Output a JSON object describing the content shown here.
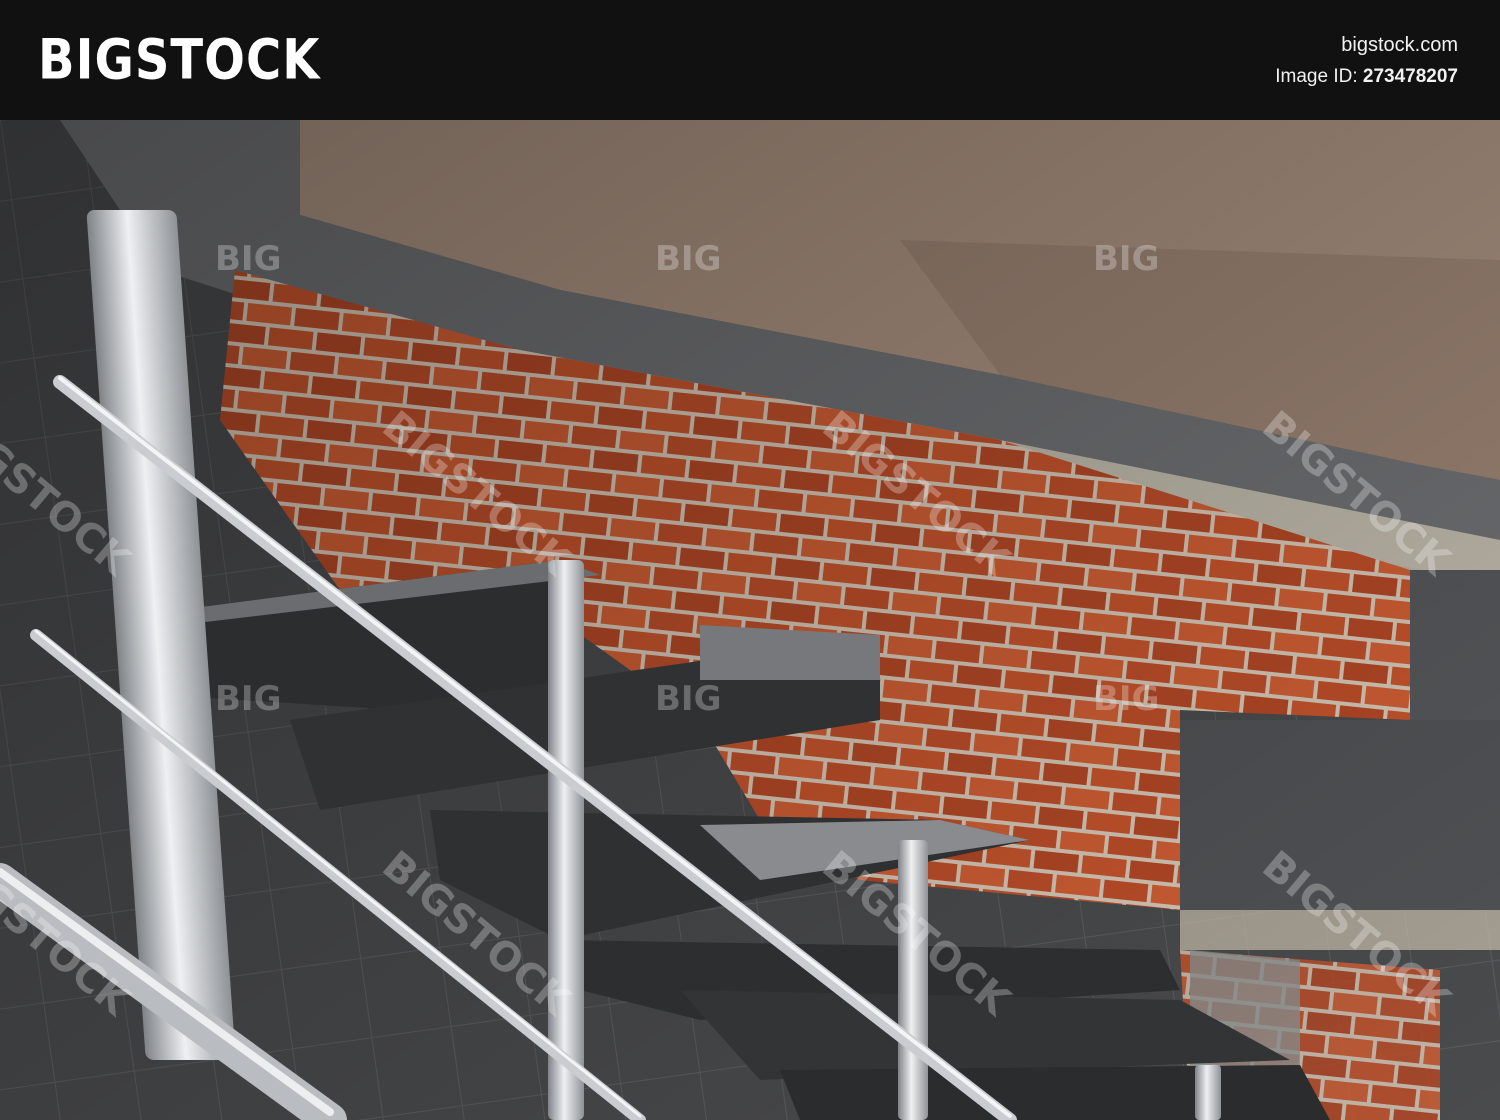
{
  "banner": {
    "logo": "BIGSTOCK",
    "site": "bigstock.com",
    "image_id_label": "Image ID:",
    "image_id_value": "273478207"
  },
  "watermark": {
    "short": "BIG",
    "long": "BIGSTOCK"
  },
  "colors": {
    "banner": "#111111",
    "brick": "#c5542c",
    "tile": "#4a4b4d",
    "concrete": "#a8907f",
    "steel": "#c9ccd0"
  }
}
